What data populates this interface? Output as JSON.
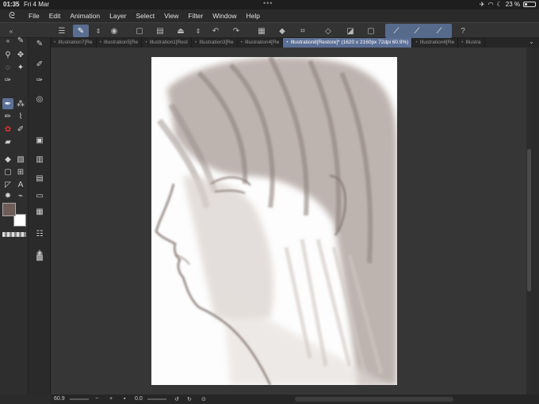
{
  "status": {
    "time": "01:35",
    "date": "Fri 4 Mar",
    "battery": "23 %",
    "battery_level": 0.23
  },
  "menu": [
    "File",
    "Edit",
    "Animation",
    "Layer",
    "Select",
    "View",
    "Filter",
    "Window",
    "Help"
  ],
  "tabs": [
    {
      "label": "Illustration7[Re",
      "active": false
    },
    {
      "label": "Illustration5[Re",
      "active": false
    },
    {
      "label": "Illustration1[Rest",
      "active": false
    },
    {
      "label": "Illustration3[Re",
      "active": false
    },
    {
      "label": "Illustration4[Re",
      "active": false
    },
    {
      "label": "Illustration8[Restore]* (1620 x 2160px 72dpi 60.9%)",
      "active": true
    },
    {
      "label": "Illustration6[Re",
      "active": false
    },
    {
      "label": "Illustra",
      "active": false
    }
  ],
  "bottom": {
    "zoom": "60.9",
    "rotation": "0.0"
  },
  "colors": {
    "main_color": "#6e5c58",
    "sub_color": "#ffffff",
    "accent": "#5b6f96"
  }
}
